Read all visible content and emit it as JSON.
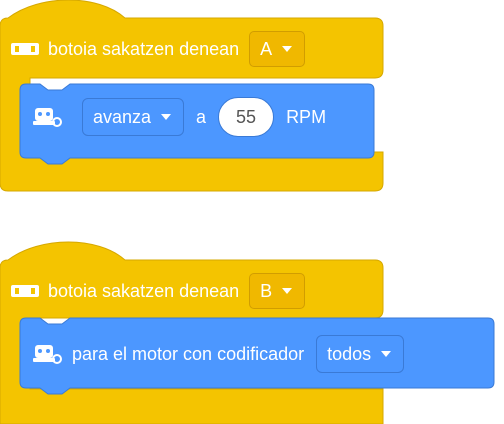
{
  "colors": {
    "hat_yellow": "#f4c400",
    "hat_border": "#d6a800",
    "motor_blue": "#4c97ff",
    "blue_border": "#3a7ad6",
    "text": "#ffffff"
  },
  "scripts": [
    {
      "hat": {
        "icon": "button-hub-icon",
        "label": "botoia sakatzen denean",
        "dropdown_value": "A"
      },
      "block": {
        "icon": "motor-robot-icon",
        "dropdown_value": "avanza",
        "connector": "a",
        "value": "55",
        "unit": "RPM"
      }
    },
    {
      "hat": {
        "icon": "button-hub-icon",
        "label": "botoia sakatzen denean",
        "dropdown_value": "B"
      },
      "block": {
        "icon": "motor-robot-icon",
        "label": "para el motor con codificador",
        "dropdown_value": "todos"
      }
    }
  ]
}
